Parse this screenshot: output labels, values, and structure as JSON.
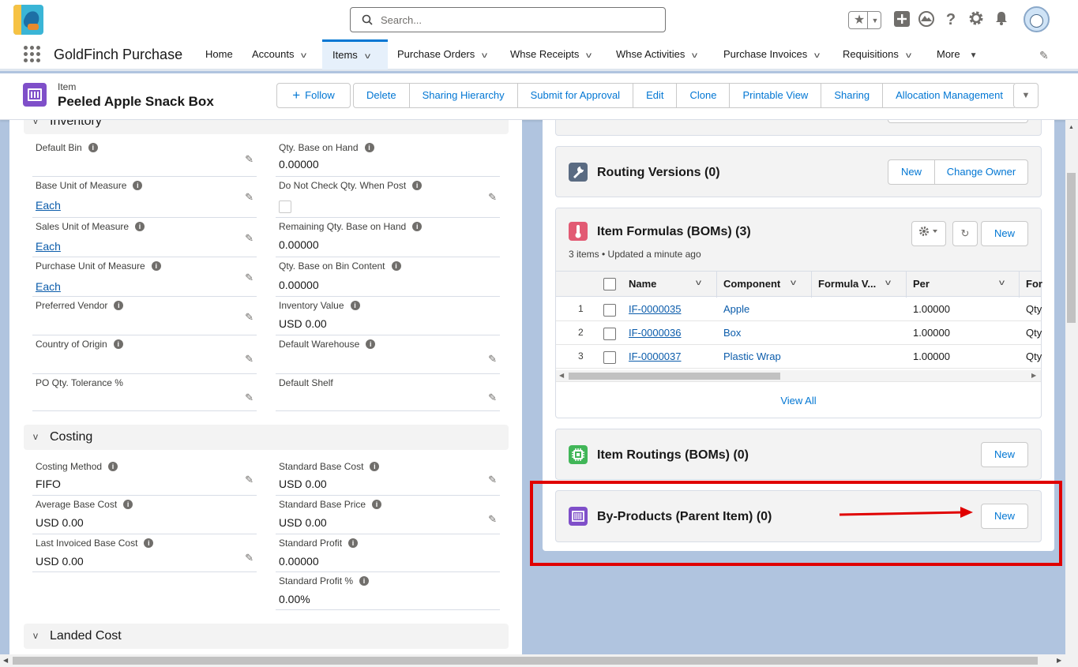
{
  "header": {
    "search_placeholder": "Search...",
    "app_name": "GoldFinch Purchase",
    "nav": [
      {
        "label": "Home"
      },
      {
        "label": "Accounts"
      },
      {
        "label": "Items"
      },
      {
        "label": "Purchase Orders"
      },
      {
        "label": "Whse Receipts"
      },
      {
        "label": "Whse Activities"
      },
      {
        "label": "Purchase Invoices"
      },
      {
        "label": "Requisitions"
      },
      {
        "label": "More"
      }
    ],
    "icons": [
      "star-icon",
      "add-icon",
      "trailhead-icon",
      "help-icon",
      "setup-gear-icon",
      "notifications-bell-icon",
      "avatar"
    ]
  },
  "record": {
    "type": "Item",
    "title": "Peeled Apple Snack Box",
    "follow_label": "Follow",
    "actions": [
      "Delete",
      "Sharing Hierarchy",
      "Submit for Approval",
      "Edit",
      "Clone",
      "Printable View",
      "Sharing",
      "Allocation Management"
    ]
  },
  "inventory": {
    "section": "Inventory",
    "fields": [
      {
        "label": "Default Bin",
        "value": "",
        "info": true,
        "editable": true
      },
      {
        "label": "Qty. Base on Hand",
        "value": "0.00000",
        "info": true,
        "editable": false
      },
      {
        "label": "Base Unit of Measure",
        "value": "Each",
        "info": true,
        "editable": true,
        "link": true
      },
      {
        "label": "Do Not Check Qty. When Post",
        "value": "",
        "info": true,
        "editable": true,
        "checkbox": true
      },
      {
        "label": "Sales Unit of Measure",
        "value": "Each",
        "info": true,
        "editable": true,
        "link": true
      },
      {
        "label": "Remaining Qty. Base on Hand",
        "value": "0.00000",
        "info": true,
        "editable": false
      },
      {
        "label": "Purchase Unit of Measure",
        "value": "Each",
        "info": true,
        "editable": true,
        "link": true
      },
      {
        "label": "Qty. Base on Bin Content",
        "value": "0.00000",
        "info": true,
        "editable": false
      },
      {
        "label": "Preferred Vendor",
        "value": "",
        "info": true,
        "editable": true
      },
      {
        "label": "Inventory Value",
        "value": "USD 0.00",
        "info": true,
        "editable": false
      },
      {
        "label": "Country of Origin",
        "value": "",
        "info": true,
        "editable": true
      },
      {
        "label": "Default Warehouse",
        "value": "",
        "info": true,
        "editable": true
      },
      {
        "label": "PO Qty. Tolerance %",
        "value": "",
        "info": false,
        "editable": true
      },
      {
        "label": "Default Shelf",
        "value": "",
        "info": false,
        "editable": true
      }
    ]
  },
  "costing": {
    "section": "Costing",
    "fields": [
      {
        "label": "Costing Method",
        "value": "FIFO",
        "info": true,
        "editable": true
      },
      {
        "label": "Standard Base Cost",
        "value": "USD 0.00",
        "info": true,
        "editable": true
      },
      {
        "label": "Average Base Cost",
        "value": "USD 0.00",
        "info": true,
        "editable": false
      },
      {
        "label": "Standard Base Price",
        "value": "USD 0.00",
        "info": true,
        "editable": true
      },
      {
        "label": "Last Invoiced Base Cost",
        "value": "USD 0.00",
        "info": true,
        "editable": true
      },
      {
        "label": "Standard Profit",
        "value": "0.00000",
        "info": true,
        "editable": false
      },
      {
        "label": "Standard Profit %",
        "value": "0.00%",
        "info": true,
        "editable": false
      }
    ]
  },
  "landed": {
    "section": "Landed Cost"
  },
  "routing_versions": {
    "title": "Routing Versions (0)",
    "new": "New",
    "change_owner": "Change Owner"
  },
  "formulas": {
    "title": "Item Formulas (BOMs) (3)",
    "subtitle": "3 items • Updated a minute ago",
    "new": "New",
    "columns": [
      "Name",
      "Component",
      "Formula V...",
      "Per",
      "For"
    ],
    "rows": [
      {
        "num": "1",
        "name": "IF-0000035",
        "component": "Apple",
        "per": "1.00000",
        "for": "Qty"
      },
      {
        "num": "2",
        "name": "IF-0000036",
        "component": "Box",
        "per": "1.00000",
        "for": "Qty"
      },
      {
        "num": "3",
        "name": "IF-0000037",
        "component": "Plastic Wrap",
        "per": "1.00000",
        "for": "Qty"
      }
    ],
    "view_all": "View All"
  },
  "routings": {
    "title": "Item Routings (BOMs) (0)",
    "new": "New"
  },
  "byproducts": {
    "title": "By-Products (Parent Item) (0)",
    "new": "New"
  },
  "colors": {
    "accent": "#0176d3",
    "highlight": "#e00000",
    "item_icon": "#7f4fc9"
  }
}
